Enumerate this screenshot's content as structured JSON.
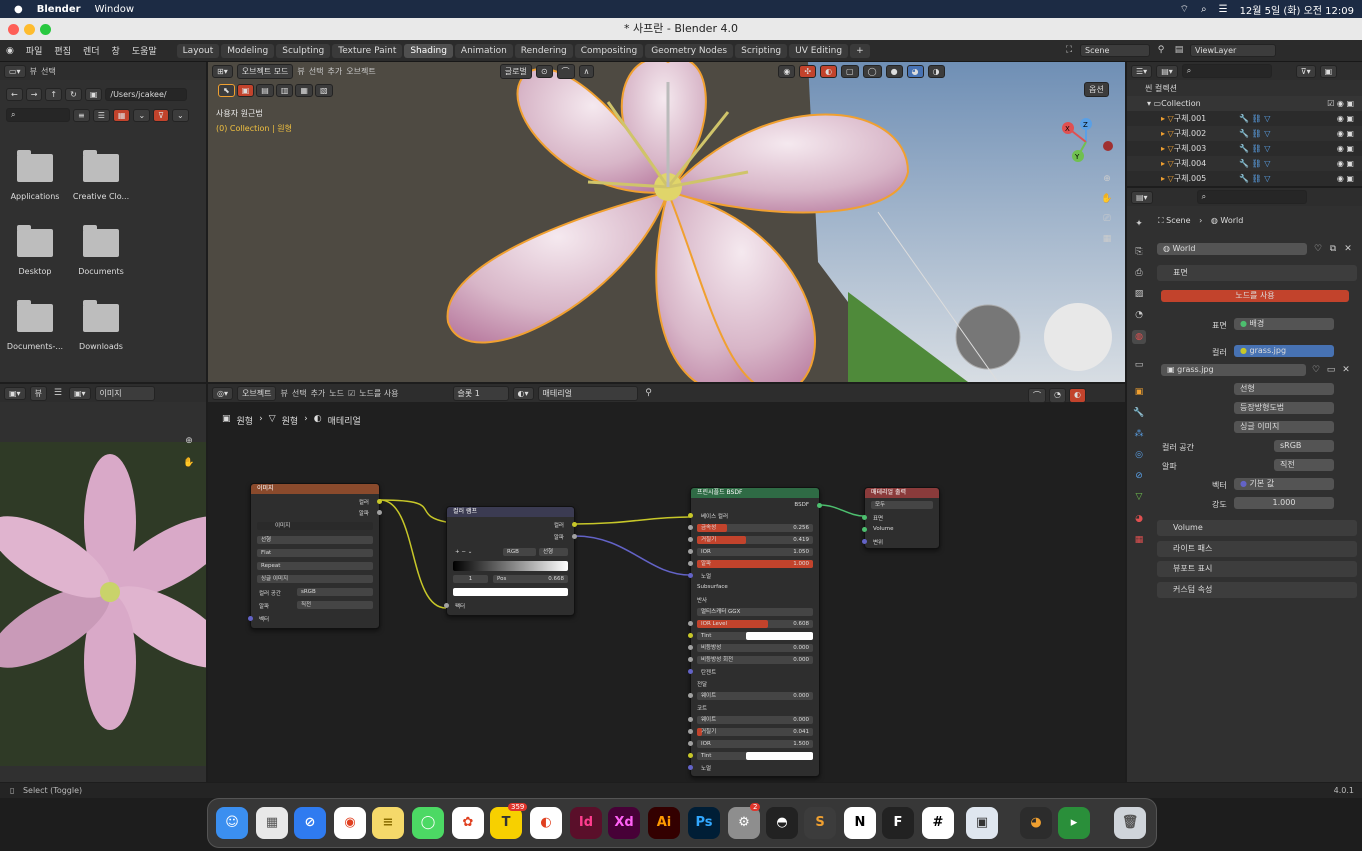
{
  "menubar": {
    "app": "Blender",
    "window": "Window",
    "clock": "12월 5일 (화) 오전 12:09"
  },
  "titlebar": {
    "title": "* 사프란 - Blender 4.0"
  },
  "topmenu": [
    "파일",
    "편집",
    "렌더",
    "창",
    "도움말"
  ],
  "workspaces": [
    "Layout",
    "Modeling",
    "Sculpting",
    "Texture Paint",
    "Shading",
    "Animation",
    "Rendering",
    "Compositing",
    "Geometry Nodes",
    "Scripting",
    "UV Editing"
  ],
  "active_workspace": "Shading",
  "scene": {
    "name": "Scene",
    "viewlayer": "ViewLayer"
  },
  "filebrowser": {
    "menu": [
      "뷰",
      "선택"
    ],
    "path": "/Users/jcakee/",
    "folders": [
      "Applications",
      "Creative Clo...",
      "Desktop",
      "Documents",
      "Documents-...",
      "Downloads"
    ]
  },
  "viewport": {
    "mode": "오브젝트 모드",
    "menus": [
      "뷰",
      "선택",
      "추가",
      "오브젝트"
    ],
    "transform": "글로벌",
    "options": "옵션",
    "info_line1": "사용자 원근법",
    "info_line2": "(0) Collection | 원형"
  },
  "imageeditor": {
    "view": "뷰",
    "image": "이미지"
  },
  "nodeeditor": {
    "object": "오브젝트",
    "menus": [
      "뷰",
      "선택",
      "추가",
      "노드"
    ],
    "use_nodes": "노드를 사용",
    "slot": "슬롯 1",
    "material": "매테리얼",
    "breadcrumb": [
      "원형",
      "원형",
      "매테리얼"
    ]
  },
  "nodes": {
    "image": {
      "title": "이미지",
      "out_color": "컬러",
      "out_alpha": "알파",
      "img_name": "이미지",
      "interp": "선형",
      "proj": "Flat",
      "ext": "Repeat",
      "source": "싱글 이미지",
      "colorspace_label": "컬러 공간",
      "colorspace": "sRGB",
      "alpha_label": "알파",
      "alpha": "직전",
      "vector": "벡터"
    },
    "ramp": {
      "title": "컬러 램프",
      "out_color": "컬러",
      "out_alpha": "알파",
      "mode": "RGB",
      "interp": "선형",
      "index": "1",
      "pos_label": "Pos",
      "pos": "0.668",
      "in_factor": "팩터"
    },
    "bsdf": {
      "title": "프린시플드 BSDF",
      "out": "BSDF",
      "rows": [
        {
          "label": "베이스 컬러",
          "value": ""
        },
        {
          "label": "금속성",
          "value": "0.256"
        },
        {
          "label": "거칠기",
          "value": "0.419"
        },
        {
          "label": "IOR",
          "value": "1.050"
        },
        {
          "label": "알파",
          "value": "1.000"
        },
        {
          "label": "노멀",
          "value": ""
        },
        {
          "label": "Subsurface",
          "value": ""
        },
        {
          "label": "반사",
          "value": ""
        },
        {
          "label": "멀티스캐터 GGX",
          "value": ""
        },
        {
          "label": "IOR Level",
          "value": "0.608"
        },
        {
          "label": "Tint",
          "value": ""
        },
        {
          "label": "비등방성",
          "value": "0.000"
        },
        {
          "label": "비등방성 회전",
          "value": "0.000"
        },
        {
          "label": "탄젠트",
          "value": ""
        },
        {
          "label": "전달",
          "value": ""
        },
        {
          "label": "웨이트",
          "value": "0.000"
        },
        {
          "label": "코트",
          "value": ""
        },
        {
          "label": "웨이트",
          "value": "0.000"
        },
        {
          "label": "거칠기",
          "value": "0.041"
        },
        {
          "label": "IOR",
          "value": "1.500"
        },
        {
          "label": "Tint",
          "value": ""
        },
        {
          "label": "노멀",
          "value": ""
        }
      ]
    },
    "output": {
      "title": "매테리얼 출력",
      "target": "모두",
      "in_surface": "표면",
      "in_volume": "Volume",
      "in_disp": "변위"
    }
  },
  "outliner": {
    "title": "씬 컬렉션",
    "collection": "Collection",
    "items": [
      "구체.001",
      "구체.002",
      "구체.003",
      "구체.004",
      "구체.005"
    ]
  },
  "properties": {
    "breadcrumb_scene": "Scene",
    "breadcrumb_world": "World",
    "world_name": "World",
    "surface_panel": "표면",
    "use_nodes_btn": "노드를 사용",
    "surface_label": "표면",
    "surface_value": "배경",
    "color_label": "컬러",
    "color_value": "grass.jpg",
    "image_name": "grass.jpg",
    "interp": "선형",
    "proj": "등장방형도법",
    "source": "싱글 이미지",
    "colorspace_label": "컬러 공간",
    "colorspace": "sRGB",
    "alpha_label": "알파",
    "alpha": "직전",
    "vector_label": "벡터",
    "vector": "기본 값",
    "strength_label": "강도",
    "strength": "1.000",
    "sections": [
      "Volume",
      "라이트 패스",
      "뷰포트 표시",
      "커스텀 속성"
    ]
  },
  "statusbar": {
    "left": "Select (Toggle)",
    "version": "4.0.1"
  },
  "dock": {
    "apps": [
      "Finder",
      "Launchpad",
      "Safari",
      "Chrome",
      "Notes",
      "Messages",
      "Photos",
      "KakaoTalk",
      "Mail",
      "InDesign",
      "Adobe XD",
      "Illustrator",
      "Photoshop",
      "System Settings",
      "Cinema",
      "Sublime",
      "Notion",
      "Figma",
      "Slack",
      "Preview",
      "Blender",
      "Xcode-like",
      "Trash"
    ],
    "talk_badge": "359",
    "settings_badge": "2"
  },
  "colors": {
    "accent": "#4772b3",
    "active_red": "#c2432c",
    "selection_orange": "#f0a030"
  }
}
